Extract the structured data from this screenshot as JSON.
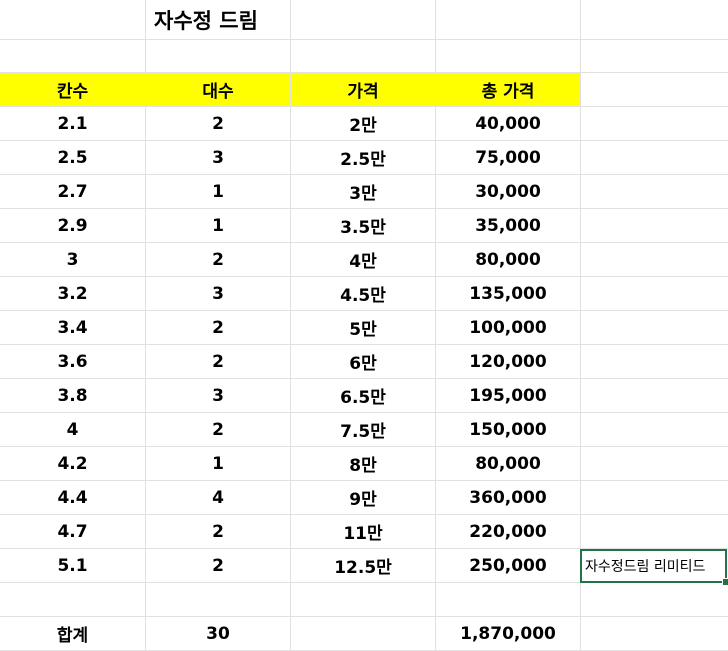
{
  "title": "자수정 드림",
  "headers": [
    "칸수",
    "대수",
    "가격",
    "총 가격"
  ],
  "rows": [
    [
      "2.1",
      "2",
      "2만",
      "40,000"
    ],
    [
      "2.5",
      "3",
      "2.5만",
      "75,000"
    ],
    [
      "2.7",
      "1",
      "3만",
      "30,000"
    ],
    [
      "2.9",
      "1",
      "3.5만",
      "35,000"
    ],
    [
      "3",
      "2",
      "4만",
      "80,000"
    ],
    [
      "3.2",
      "3",
      "4.5만",
      "135,000"
    ],
    [
      "3.4",
      "2",
      "5만",
      "100,000"
    ],
    [
      "3.6",
      "2",
      "6만",
      "120,000"
    ],
    [
      "3.8",
      "3",
      "6.5만",
      "195,000"
    ],
    [
      "4",
      "2",
      "7.5만",
      "150,000"
    ],
    [
      "4.2",
      "1",
      "8만",
      "80,000"
    ],
    [
      "4.4",
      "4",
      "9만",
      "360,000"
    ],
    [
      "4.7",
      "2",
      "11만",
      "220,000"
    ],
    [
      "5.1",
      "2",
      "12.5만",
      "250,000"
    ]
  ],
  "note_cell": "자수정드림 리미티드",
  "total": {
    "label": "합계",
    "count": "30",
    "sum": "1,870,000"
  },
  "colors": {
    "header_fill": "#ffff00",
    "grid": "#e1e1e1",
    "selection": "#217346"
  }
}
